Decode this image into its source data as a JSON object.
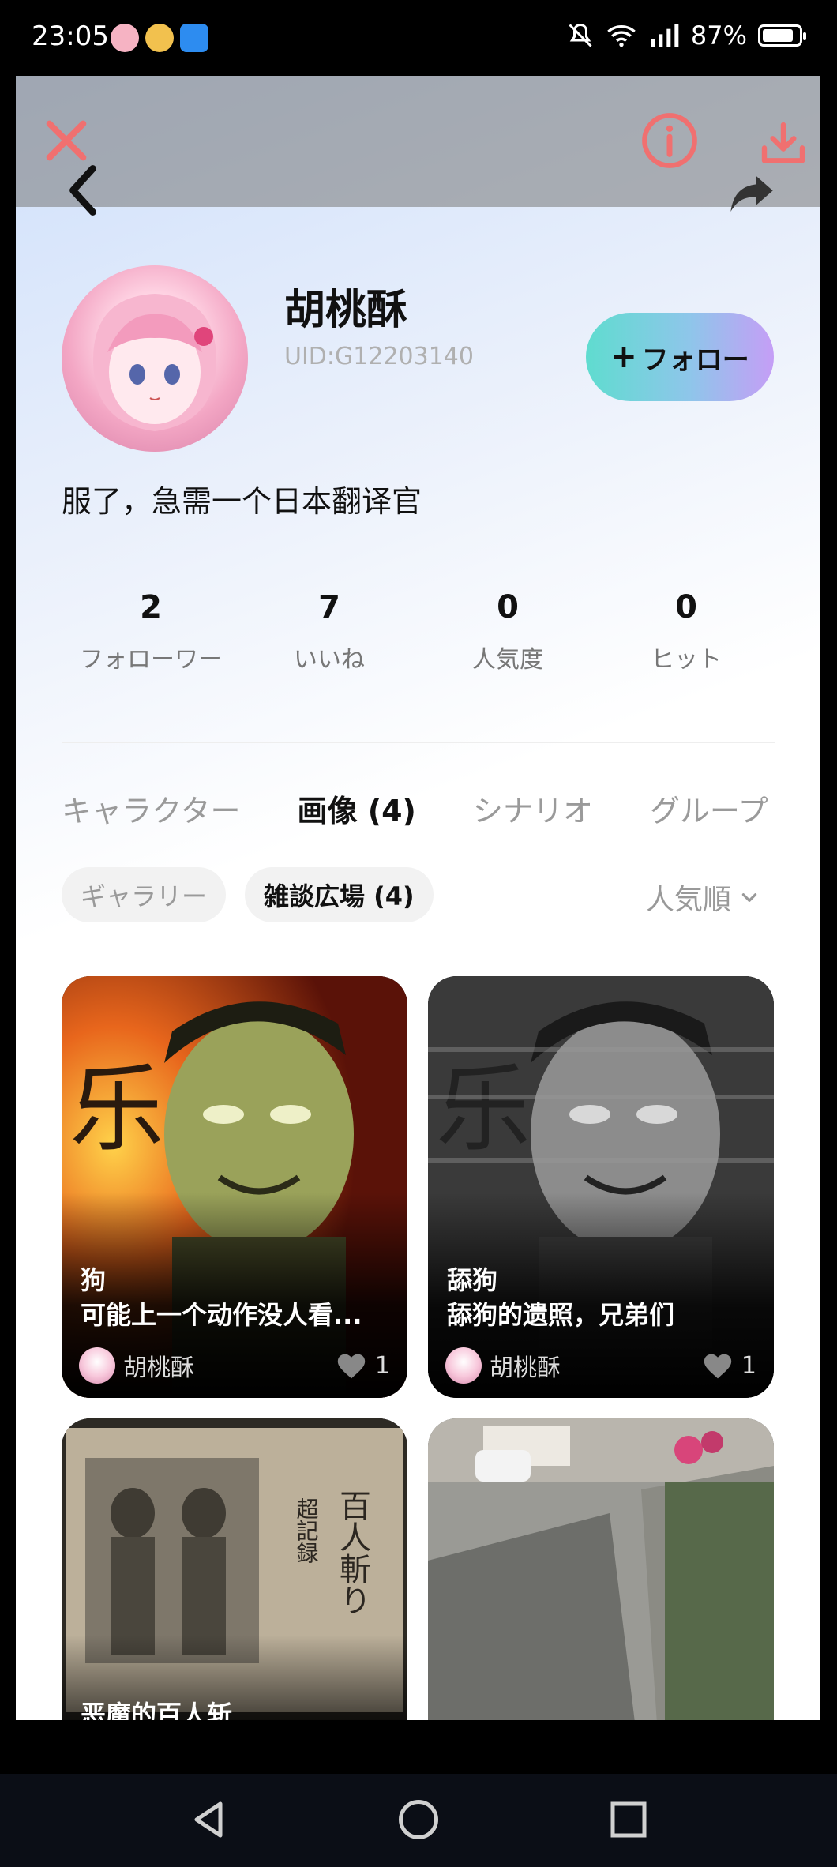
{
  "status_bar": {
    "time": "23:05",
    "battery_text": "87%",
    "battery_level": 0.87,
    "icons": [
      "notification-app-icon",
      "game-app-icon",
      "clipboard-app-icon",
      "bell-off-icon",
      "wifi-icon",
      "signal-icon",
      "battery-icon"
    ]
  },
  "toolbar": {
    "icons": [
      "close-icon",
      "back-icon",
      "info-icon",
      "download-icon",
      "share-icon"
    ],
    "accent_color": "#f07070"
  },
  "profile": {
    "name": "胡桃酥",
    "uid": "UID:G12203140",
    "bio": "服了，急需一个日本翻译官",
    "follow_label": "フォロー"
  },
  "stats": [
    {
      "value": "2",
      "label": "フォローワー"
    },
    {
      "value": "7",
      "label": "いいね"
    },
    {
      "value": "0",
      "label": "人気度"
    },
    {
      "value": "0",
      "label": "ヒット"
    }
  ],
  "tabs": [
    {
      "label": "キャラクター",
      "active": false
    },
    {
      "label": "画像 (4)",
      "active": true
    },
    {
      "label": "シナリオ",
      "active": false
    },
    {
      "label": "グループ",
      "active": false
    }
  ],
  "filters": [
    {
      "label": "ギャラリー",
      "active": false
    },
    {
      "label": "雑談広場 (4)",
      "active": true
    }
  ],
  "sort_label": "人気順",
  "posts": [
    {
      "tag": "狗",
      "title": "可能上一个动作没人看...",
      "author": "胡桃酥",
      "likes": "1"
    },
    {
      "tag": "舔狗",
      "title": "舔狗的遗照，兄弟们",
      "author": "胡桃酥",
      "likes": "1"
    },
    {
      "tag": "",
      "title": "恶魔的百人斩",
      "author": "",
      "likes": ""
    },
    {
      "tag": "",
      "title": "",
      "author": "",
      "likes": ""
    }
  ],
  "nav_bar": {
    "icons": [
      "back-triangle-icon",
      "home-circle-icon",
      "recents-square-icon"
    ]
  }
}
